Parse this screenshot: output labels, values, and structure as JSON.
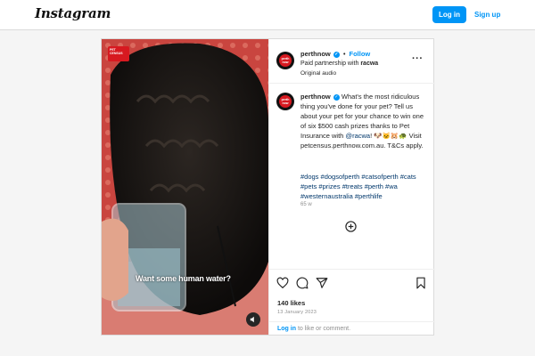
{
  "brand": {
    "logo_text": "Instagram"
  },
  "topbar": {
    "login_label": "Log in",
    "signup_label": "Sign up"
  },
  "media": {
    "overlay_caption": "Want some human water?",
    "badge_text": "PET CENSUS",
    "avatar_line1": "perth",
    "avatar_line2": "now"
  },
  "post": {
    "username": "perthnow",
    "follow_label": "Follow",
    "dot": "•",
    "paid_prefix": "Paid partnership with ",
    "partner": "racwa",
    "audio": "Original audio",
    "caption_text": " What's the most ridiculous thing you've done for your pet? Tell us about your pet for your chance to win one of six $500 cash prizes thanks to Pet Insurance with ",
    "caption_mention": "@racwa",
    "caption_tail": "! 🐶🐱🐹🐢 Visit petcensus.perthnow.com.au. T&Cs apply.",
    "hashtags": "#dogs #dogsofperth #catsofperth #cats #pets #prizes #treats #perth #wa #westernaustralia #perthlife",
    "age": "65 w",
    "likes": "140 likes",
    "date": "13 January 2023",
    "login_link": "Log in",
    "login_suffix": " to like or comment."
  },
  "colors": {
    "accent": "#0095f6",
    "brand_red": "#d71920",
    "link_dark": "#00376b"
  },
  "icons": [
    "verified-icon",
    "more-options-icon",
    "add-comment-icon",
    "heart-icon",
    "comment-icon",
    "share-icon",
    "bookmark-icon",
    "audio-icon"
  ]
}
